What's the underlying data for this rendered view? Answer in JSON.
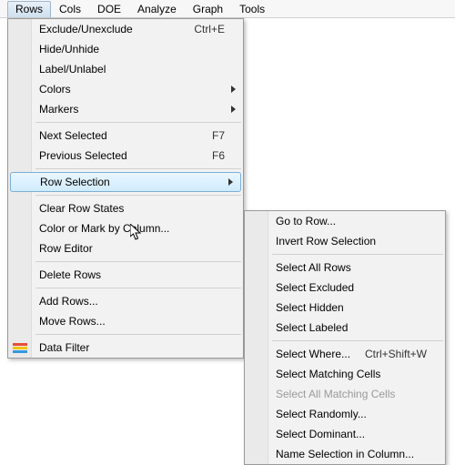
{
  "menubar": {
    "items": [
      "Rows",
      "Cols",
      "DOE",
      "Analyze",
      "Graph",
      "Tools"
    ],
    "active_index": 0
  },
  "menu1": {
    "items": [
      {
        "label": "Exclude/Unexclude",
        "shortcut": "Ctrl+E"
      },
      {
        "label": "Hide/Unhide"
      },
      {
        "label": "Label/Unlabel"
      },
      {
        "label": "Colors",
        "submenu": true
      },
      {
        "label": "Markers",
        "submenu": true
      },
      {
        "sep": true
      },
      {
        "label": "Next Selected",
        "shortcut": "F7"
      },
      {
        "label": "Previous Selected",
        "shortcut": "F6"
      },
      {
        "sep": true
      },
      {
        "label": "Row Selection",
        "submenu": true,
        "highlight": true
      },
      {
        "sep": true
      },
      {
        "label": "Clear Row States"
      },
      {
        "label": "Color or Mark by Column..."
      },
      {
        "label": "Row Editor"
      },
      {
        "sep": true
      },
      {
        "label": "Delete Rows"
      },
      {
        "sep": true
      },
      {
        "label": "Add Rows..."
      },
      {
        "label": "Move Rows..."
      },
      {
        "sep": true
      },
      {
        "label": "Data Filter",
        "icon": "data-filter-icon"
      }
    ]
  },
  "menu2": {
    "items": [
      {
        "label": "Go to Row..."
      },
      {
        "label": "Invert Row Selection"
      },
      {
        "sep": true
      },
      {
        "label": "Select All Rows"
      },
      {
        "label": "Select Excluded"
      },
      {
        "label": "Select Hidden"
      },
      {
        "label": "Select Labeled"
      },
      {
        "sep": true
      },
      {
        "label": "Select Where...",
        "shortcut": "Ctrl+Shift+W"
      },
      {
        "label": "Select Matching Cells"
      },
      {
        "label": "Select All Matching Cells",
        "disabled": true
      },
      {
        "label": "Select Randomly..."
      },
      {
        "label": "Select Dominant..."
      },
      {
        "label": "Name Selection in Column..."
      }
    ]
  }
}
